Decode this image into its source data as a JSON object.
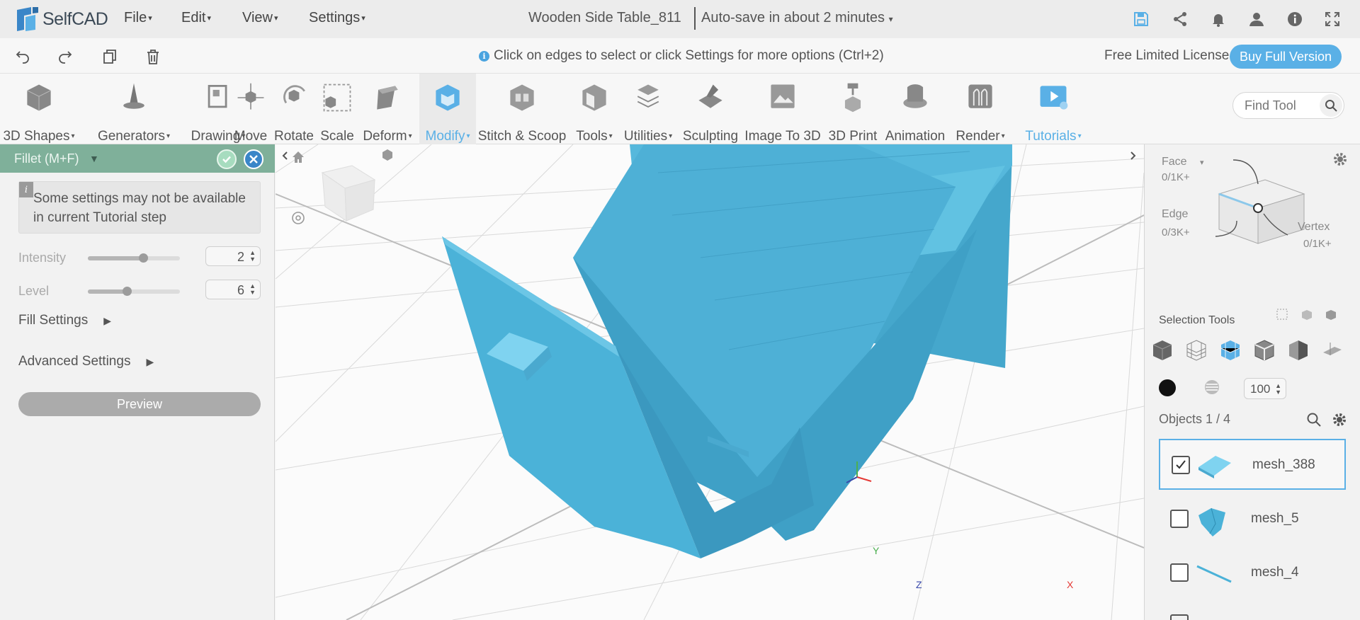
{
  "app": {
    "logo_text": "SelfCAD",
    "menus": [
      "File",
      "Edit",
      "View",
      "Settings"
    ],
    "document_title": "Wooden Side Table_811",
    "autosave_text": "Auto-save in about 2 minutes"
  },
  "subbar": {
    "hint": "Click on edges to select or click Settings for more options (Ctrl+2)",
    "license": "Free Limited License",
    "buy_label": "Buy Full Version"
  },
  "toolbar": {
    "tools": [
      {
        "label": "3D Shapes",
        "dropdown": true
      },
      {
        "label": "Generators",
        "dropdown": true
      },
      {
        "label": "Drawing",
        "dropdown": true
      },
      {
        "label": "Move",
        "dropdown": false
      },
      {
        "label": "Rotate",
        "dropdown": false
      },
      {
        "label": "Scale",
        "dropdown": false
      },
      {
        "label": "Deform",
        "dropdown": true
      },
      {
        "label": "Modify",
        "dropdown": true,
        "active": true
      },
      {
        "label": "Stitch & Scoop",
        "dropdown": false
      },
      {
        "label": "Tools",
        "dropdown": true
      },
      {
        "label": "Utilities",
        "dropdown": true
      },
      {
        "label": "Sculpting",
        "dropdown": false
      },
      {
        "label": "Image To 3D",
        "dropdown": false
      },
      {
        "label": "3D Print",
        "dropdown": false
      },
      {
        "label": "Animation",
        "dropdown": false
      },
      {
        "label": "Render",
        "dropdown": true
      },
      {
        "label": "Tutorials",
        "dropdown": true,
        "accent": true
      }
    ],
    "find_placeholder": "Find Tool"
  },
  "left_panel": {
    "title": "Fillet (M+F)",
    "notice": "Some settings may not be available in current Tutorial step",
    "intensity": {
      "label": "Intensity",
      "value": "2",
      "slider_fraction": 0.6
    },
    "level": {
      "label": "Level",
      "value": "6",
      "slider_fraction": 0.42
    },
    "fill_settings": "Fill Settings",
    "advanced_settings": "Advanced Settings",
    "preview_label": "Preview"
  },
  "viewport": {
    "axes": {
      "x": "X",
      "y": "Y",
      "z": "Z"
    }
  },
  "right_panel": {
    "face_label": "Face",
    "face_count": "0/1K+",
    "edge_label": "Edge",
    "edge_count": "0/3K+",
    "vertex_label": "Vertex",
    "vertex_count": "0/1K+",
    "selection_tools_label": "Selection Tools",
    "opacity_value": "100",
    "objects_label": "Objects 1 / 4",
    "objects": [
      {
        "name": "mesh_388",
        "checked": true
      },
      {
        "name": "mesh_5",
        "checked": false
      },
      {
        "name": "mesh_4",
        "checked": false
      }
    ]
  },
  "colors": {
    "accent": "#5ab0e6",
    "model": "#4bb4d8",
    "panel_header": "#7fb09a"
  }
}
